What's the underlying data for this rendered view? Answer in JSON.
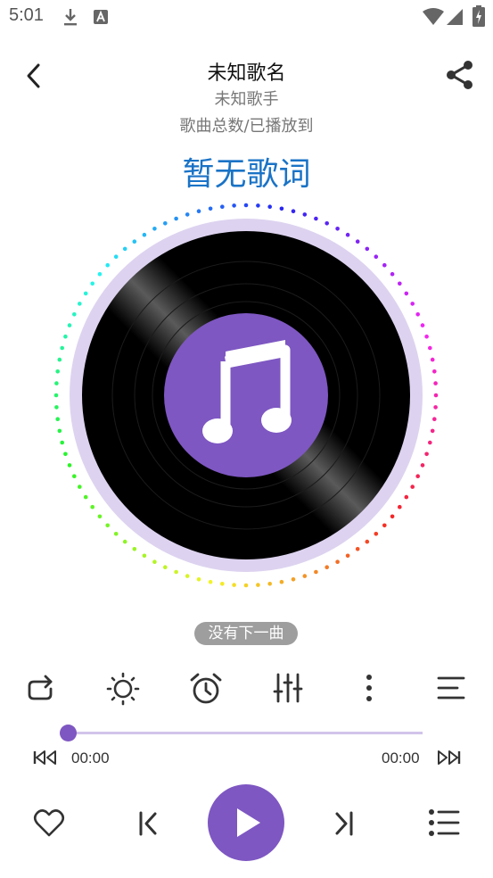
{
  "status_bar": {
    "time": "5:01"
  },
  "song": {
    "title": "未知歌名",
    "artist": "未知歌手",
    "progress_info": "歌曲总数/已播放到"
  },
  "lyrics": {
    "text": "暂无歌词"
  },
  "toast": {
    "text": "没有下一曲"
  },
  "player": {
    "current_time": "00:00",
    "total_time": "00:00",
    "progress": 0
  },
  "colors": {
    "accent": "#7e57c2",
    "lyrics": "#1a73c6",
    "disc_ring": "#ddd3f0",
    "progress_track": "#d1c4e9"
  },
  "icons": {
    "header": [
      "back-icon",
      "share-icon"
    ],
    "tools": [
      "repeat-icon",
      "brightness-icon",
      "alarm-icon",
      "equalizer-icon",
      "more-vert-icon",
      "lyrics-align-icon"
    ],
    "controls": [
      "favorite-icon",
      "previous-icon",
      "play-icon",
      "next-icon",
      "playlist-icon"
    ]
  }
}
